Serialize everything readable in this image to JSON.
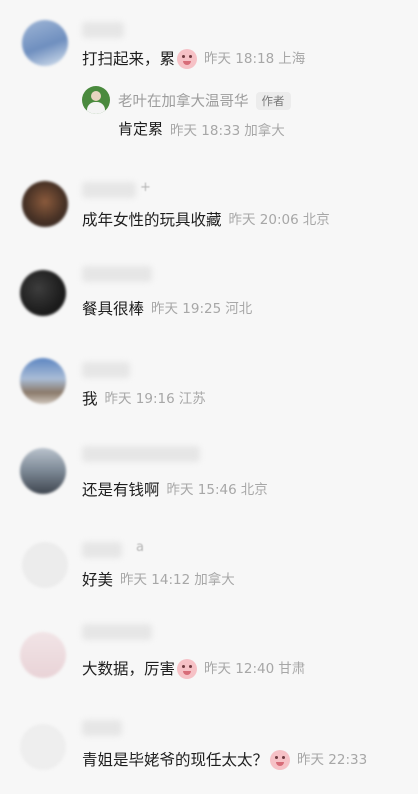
{
  "comments": [
    {
      "text": "打扫起来，累",
      "emoji": "sob-emoji",
      "time": "昨天 18:18",
      "location": "上海",
      "name_suffix": "",
      "reply": {
        "author": "老叶在加拿大温哥华",
        "badge": "作者",
        "text": "肯定累",
        "time": "昨天 18:33",
        "location": "加拿大"
      }
    },
    {
      "text": "成年女性的玩具收藏",
      "time": "昨天 20:06",
      "location": "北京",
      "name_suffix": "+"
    },
    {
      "text": "餐具很棒",
      "time": "昨天 19:25",
      "location": "河北",
      "name_suffix": ""
    },
    {
      "text": "我",
      "time": "昨天 19:16",
      "location": "江苏",
      "name_suffix": ""
    },
    {
      "text": "还是有钱啊",
      "time": "昨天 15:46",
      "location": "北京",
      "name_suffix": ""
    },
    {
      "text": "好美",
      "time": "昨天 14:12",
      "location": "加拿大",
      "name_suffix": "a"
    },
    {
      "text": "大数据，厉害",
      "emoji": "sob-emoji",
      "time": "昨天 12:40",
      "location": "甘肃",
      "name_suffix": ""
    },
    {
      "text": "青姐是毕姥爷的现任太太？",
      "emoji": "sob-emoji",
      "time": "昨天 22:33",
      "location": "",
      "name_suffix": ""
    }
  ],
  "colors": {
    "background": "#f7f7f7",
    "meta": "#a7a7a7",
    "text": "#1e1e1e",
    "emoji": "#f6c1c6"
  }
}
